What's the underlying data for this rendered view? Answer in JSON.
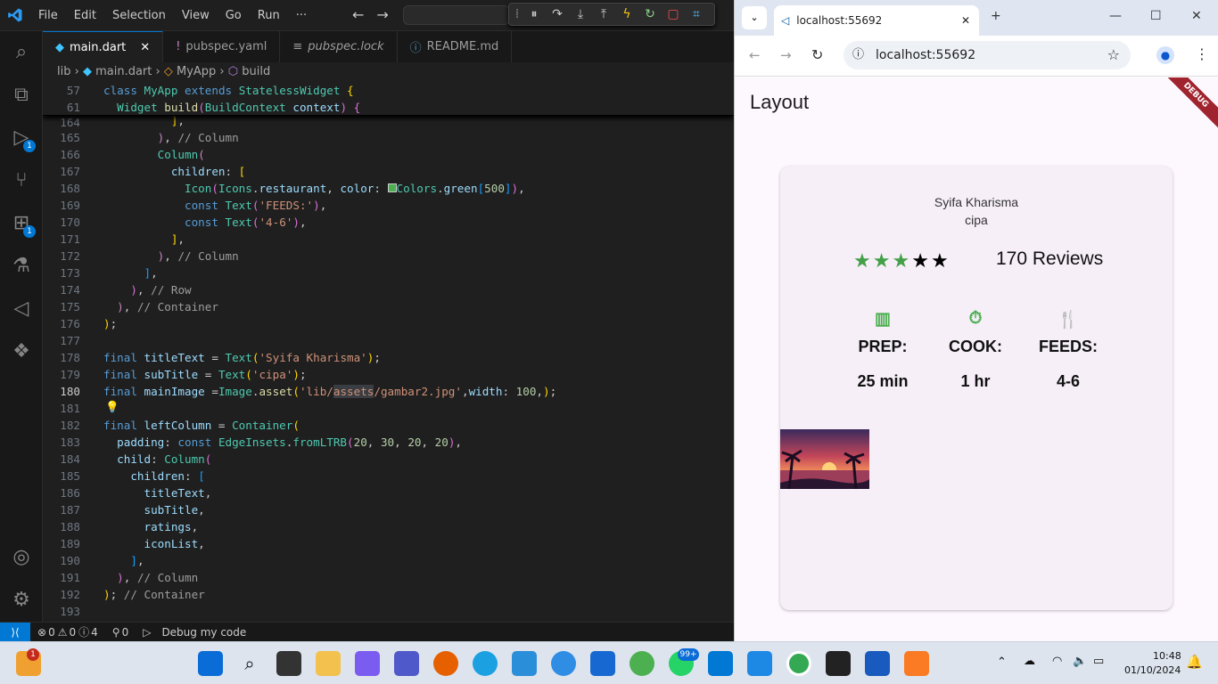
{
  "vscode": {
    "menu": [
      "File",
      "Edit",
      "Selection",
      "View",
      "Go",
      "Run",
      "···"
    ],
    "badges": {
      "debug": "1",
      "extensions": "1"
    },
    "tabs": [
      {
        "label": "main.dart",
        "icon": "dart-icon",
        "active": true
      },
      {
        "label": "pubspec.yaml",
        "icon": "yaml-icon",
        "active": false
      },
      {
        "label": "pubspec.lock",
        "icon": "lock-file-icon",
        "active": false
      },
      {
        "label": "README.md",
        "icon": "info-icon",
        "active": false
      }
    ],
    "breadcrumb": [
      "lib",
      "main.dart",
      "MyApp",
      "build"
    ],
    "status": {
      "errors": "0",
      "warnings": "0",
      "infos": "4",
      "ports": "0",
      "debug": "Debug my code"
    }
  },
  "browser": {
    "tab_title": "localhost:55692",
    "url": "localhost:55692",
    "app_title": "Layout",
    "debug_banner": "DEBUG",
    "card": {
      "title": "Syifa Kharisma",
      "subtitle": "cipa",
      "stars_filled": 3,
      "stars_total": 5,
      "reviews": "170 Reviews",
      "columns": [
        {
          "label": "PREP:",
          "value": "25 min",
          "icon": "kitchen-icon"
        },
        {
          "label": "COOK:",
          "value": "1 hr",
          "icon": "timer-icon"
        },
        {
          "label": "FEEDS:",
          "value": "4-6",
          "icon": "restaurant-icon"
        }
      ]
    },
    "colors": {
      "star_filled": "#43a047",
      "icon_green": "#4caf50"
    }
  },
  "taskbar": {
    "time": "10:48",
    "date": "01/10/2024",
    "whatsapp_badge": "99+",
    "start_badge": "1"
  }
}
